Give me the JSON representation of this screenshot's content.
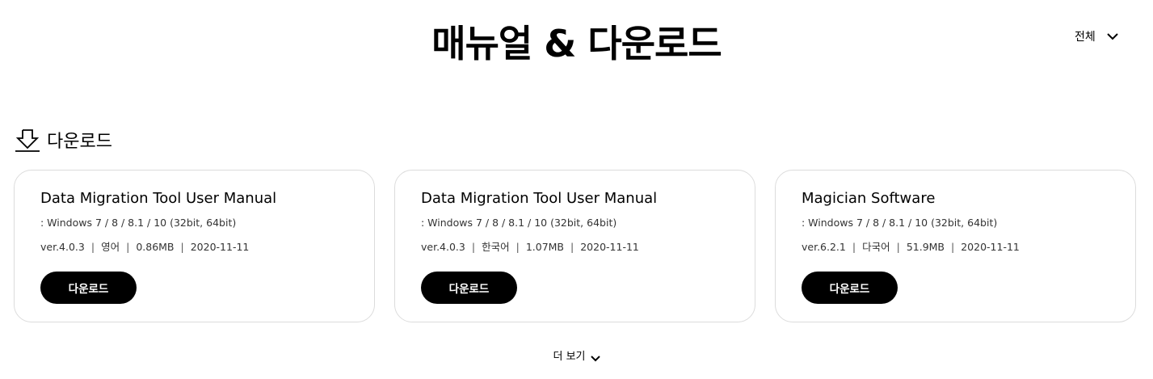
{
  "page": {
    "title": "매뉴얼 & 다운로드"
  },
  "filter": {
    "selected": "전체",
    "icon": "chevron-down-icon"
  },
  "section": {
    "icon": "download-icon",
    "title": "다운로드"
  },
  "cards": [
    {
      "title": "Data Migration Tool User Manual",
      "os": ": Windows 7 / 8 / 8.1 / 10 (32bit, 64bit)",
      "version": "ver.4.0.3",
      "language": "영어",
      "size": "0.86MB",
      "date": "2020-11-11",
      "button_label": "다운로드"
    },
    {
      "title": "Data Migration Tool User Manual",
      "os": ": Windows 7 / 8 / 8.1 / 10 (32bit, 64bit)",
      "version": "ver.4.0.3",
      "language": "한국어",
      "size": "1.07MB",
      "date": "2020-11-11",
      "button_label": "다운로드"
    },
    {
      "title": "Magician Software",
      "os": ": Windows 7 / 8 / 8.1 / 10 (32bit, 64bit)",
      "version": "ver.6.2.1",
      "language": "다국어",
      "size": "51.9MB",
      "date": "2020-11-11",
      "button_label": "다운로드"
    }
  ],
  "separator": "|",
  "more": {
    "label": "더 보기",
    "icon": "chevron-down-icon"
  },
  "colors": {
    "accent": "#000000",
    "card_border": "#dcdcdc",
    "button_text": "#ffffff"
  }
}
